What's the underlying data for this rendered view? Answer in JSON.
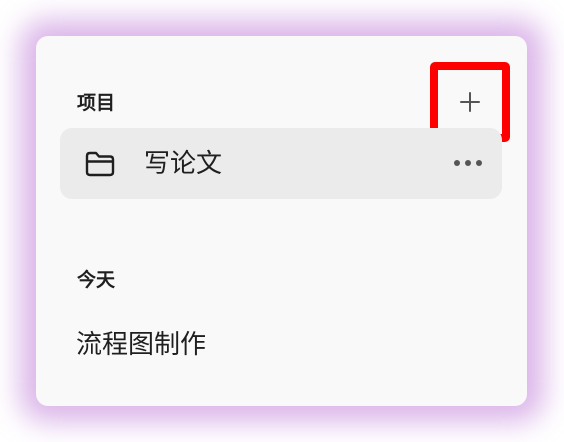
{
  "projects": {
    "header": "项目",
    "add_icon": "plus-icon",
    "items": [
      {
        "label": "写论文",
        "icon": "folder-icon",
        "more_icon": "more-horizontal-icon",
        "selected": true
      }
    ]
  },
  "today": {
    "header": "今天",
    "items": [
      {
        "label": "流程图制作"
      }
    ]
  },
  "colors": {
    "highlight_border": "#ff0000",
    "glow": "#c48ad8",
    "panel_bg": "#f9f9f9",
    "item_selected_bg": "#ebebeb",
    "text": "#1f1f1f",
    "icon": "#555555"
  }
}
